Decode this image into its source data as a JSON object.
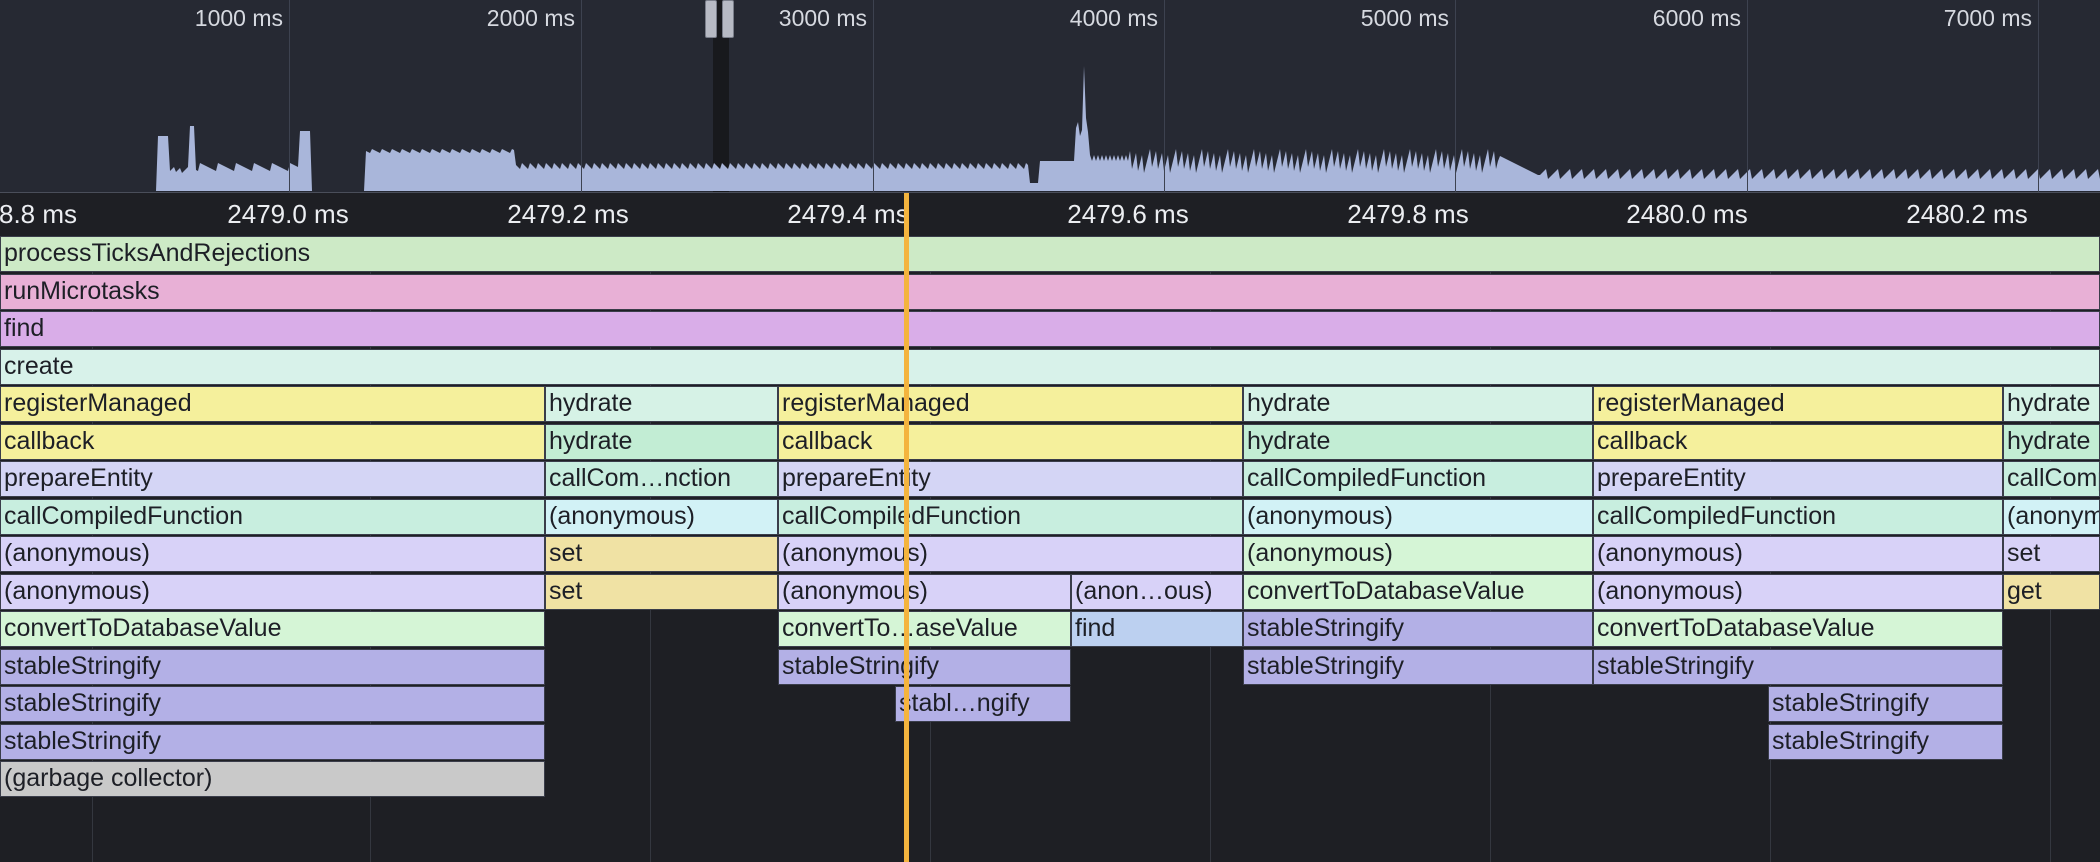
{
  "overview": {
    "tick_labels": [
      "1000 ms",
      "2000 ms",
      "3000 ms",
      "4000 ms",
      "5000 ms",
      "6000 ms",
      "7000 ms"
    ]
  },
  "ruler": {
    "labels": [
      "8.8 ms",
      "2479.0 ms",
      "2479.2 ms",
      "2479.4 ms",
      "2479.6 ms",
      "2479.8 ms",
      "2480.0 ms",
      "2480.2 ms"
    ]
  },
  "colors": {
    "processTicksAndRejections": "#cdeac6",
    "runMicrotasks": "#e8b0d6",
    "find_purple": "#d9ade8",
    "create": "#d8f2ea",
    "yellow": "#f5f09c",
    "hydrate_light": "#d6f2e6",
    "hydrate_green": "#c2edd4",
    "lavender": "#d4d5f5",
    "mint": "#c8eedf",
    "cyan": "#d2f2f6",
    "lilac": "#d8d2f8",
    "tan": "#f0e2a4",
    "pale_green": "#d5f5d6",
    "blue": "#bcd0f0",
    "violet": "#b3b0e6",
    "gray": "#c9c9c9",
    "cursor": "#f4b43e"
  },
  "flame": {
    "rows": [
      [
        {
          "name": "processTicksAndRejections",
          "c": "processTicksAndRejections"
        }
      ],
      [
        {
          "name": "runMicrotasks",
          "c": "runMicrotasks"
        }
      ],
      [
        {
          "name": "find",
          "c": "find_purple"
        }
      ],
      [
        {
          "name": "create",
          "c": "create"
        }
      ],
      [
        {
          "name": "registerManaged",
          "c": "yellow"
        },
        {
          "name": "hydrate",
          "c": "hydrate_light"
        },
        {
          "name": "registerManaged",
          "c": "yellow"
        },
        {
          "name": "hydrate",
          "c": "hydrate_light"
        },
        {
          "name": "registerManaged",
          "c": "yellow"
        },
        {
          "name": "hydrate",
          "c": "hydrate_light"
        }
      ],
      [
        {
          "name": "callback",
          "c": "yellow"
        },
        {
          "name": "hydrate",
          "c": "hydrate_green"
        },
        {
          "name": "callback",
          "c": "yellow"
        },
        {
          "name": "hydrate",
          "c": "hydrate_green"
        },
        {
          "name": "callback",
          "c": "yellow"
        },
        {
          "name": "hydrate",
          "c": "hydrate_green"
        }
      ],
      [
        {
          "name": "prepareEntity",
          "c": "lavender"
        },
        {
          "name": "callCom…nction",
          "c": "mint"
        },
        {
          "name": "prepareEntity",
          "c": "lavender"
        },
        {
          "name": "callCompiledFunction",
          "c": "mint"
        },
        {
          "name": "prepareEntity",
          "c": "lavender"
        },
        {
          "name": "callCompiledFunction",
          "c": "mint"
        }
      ],
      [
        {
          "name": "callCompiledFunction",
          "c": "mint"
        },
        {
          "name": "(anonymous)",
          "c": "cyan"
        },
        {
          "name": "callCompiledFunction",
          "c": "mint"
        },
        {
          "name": "(anonymous)",
          "c": "cyan"
        },
        {
          "name": "callCompiledFunction",
          "c": "mint"
        },
        {
          "name": "(anonymous)",
          "c": "cyan"
        }
      ],
      [
        {
          "name": "(anonymous)",
          "c": "lilac"
        },
        {
          "name": "set",
          "c": "tan"
        },
        {
          "name": "(anonymous)",
          "c": "lilac"
        },
        {
          "name": "(anonymous)",
          "c": "pale_green"
        },
        {
          "name": "(anonymous)",
          "c": "lilac"
        },
        {
          "name": "set",
          "c": "lilac"
        }
      ],
      [
        {
          "name": "(anonymous)",
          "c": "lilac"
        },
        {
          "name": "set",
          "c": "tan"
        },
        {
          "name": "(anonymous)",
          "c": "lilac"
        },
        {
          "name": "(anon…ous)",
          "c": "lilac"
        },
        {
          "name": "convertToDatabaseValue",
          "c": "pale_green"
        },
        {
          "name": "(anonymous)",
          "c": "lilac"
        },
        {
          "name": "get",
          "c": "tan"
        }
      ],
      [
        {
          "name": "convertToDatabaseValue",
          "c": "pale_green"
        },
        {
          "name": "convertTo…aseValue",
          "c": "pale_green"
        },
        {
          "name": "find",
          "c": "blue"
        },
        {
          "name": "stableStringify",
          "c": "violet"
        },
        {
          "name": "convertToDatabaseValue",
          "c": "pale_green"
        }
      ],
      [
        {
          "name": "stableStringify",
          "c": "violet"
        },
        {
          "name": "stableStringify",
          "c": "violet"
        },
        {
          "name": "stableStringify",
          "c": "violet"
        },
        {
          "name": "stableStringify",
          "c": "violet"
        }
      ],
      [
        {
          "name": "stableStringify",
          "c": "violet"
        },
        {
          "name": "stabl…ngify",
          "c": "violet"
        },
        {
          "name": "stableStringify",
          "c": "violet"
        }
      ],
      [
        {
          "name": "stableStringify",
          "c": "violet"
        },
        {
          "name": "stableStringify",
          "c": "violet"
        }
      ],
      [
        {
          "name": "(garbage collector)",
          "c": "gray"
        }
      ]
    ]
  }
}
